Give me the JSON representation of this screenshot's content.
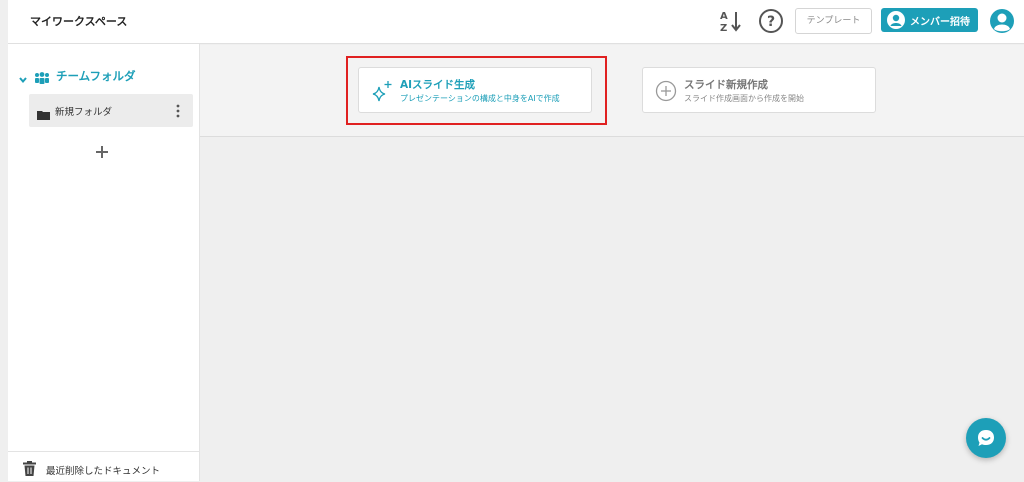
{
  "header": {
    "workspace_title": "マイワークスペース",
    "template_label": "テンプレート",
    "invite_label": "メンバー招待"
  },
  "sidebar": {
    "team_folder_label": "チームフォルダ",
    "folders": [
      {
        "label": "新規フォルダ"
      }
    ],
    "trash_label": "最近削除したドキュメント"
  },
  "main": {
    "cards": [
      {
        "title": "AIスライド生成",
        "subtitle": "プレゼンテーションの構成と中身をAIで作成"
      },
      {
        "title": "スライド新規作成",
        "subtitle": "スライド作成画面から作成を開始"
      }
    ]
  },
  "colors": {
    "accent": "#1d9fb8",
    "highlight": "#e02020",
    "background": "#efefef"
  },
  "icons": [
    "sort-az-icon",
    "help-icon",
    "user-icon",
    "chevron-down-icon",
    "people-icon",
    "folder-icon",
    "kebab-icon",
    "plus-icon",
    "trash-icon",
    "sparkle-icon",
    "plus-circle-icon",
    "chat-icon"
  ]
}
